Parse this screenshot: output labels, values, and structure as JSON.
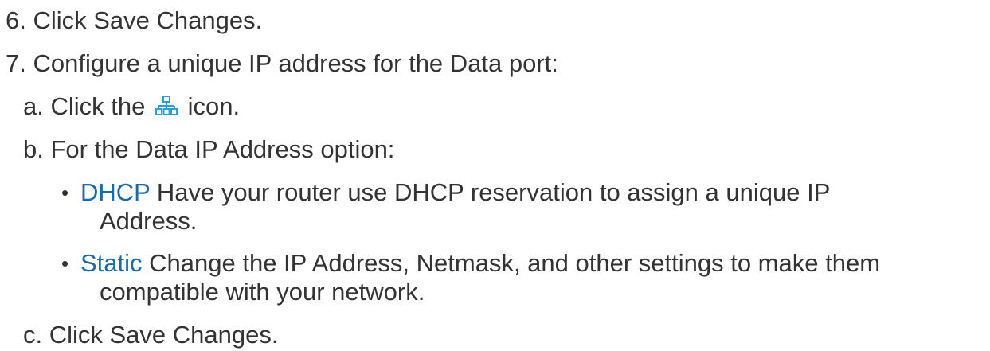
{
  "steps": {
    "step6": "6. Click Save Changes.",
    "step7": "7. Configure a unique IP address for the Data port:",
    "sub_a_before": "a. Click the",
    "sub_a_after": "icon.",
    "sub_a_icon": "network-topology-icon",
    "sub_b": "b. For the Data IP Address option:",
    "bullet_char": "•",
    "dhcp_link": "DHCP",
    "dhcp_text_1": " Have your router use DHCP reservation to assign a unique IP",
    "dhcp_text_2": "Address.",
    "static_link": "Static",
    "static_text_1": " Change the IP Address, Netmask, and other settings to make them",
    "static_text_2": "compatible with your network.",
    "sub_c": "c. Click Save Changes."
  },
  "colors": {
    "text": "#333333",
    "link": "#1b6aa8",
    "icon": "#2a9fd6"
  }
}
